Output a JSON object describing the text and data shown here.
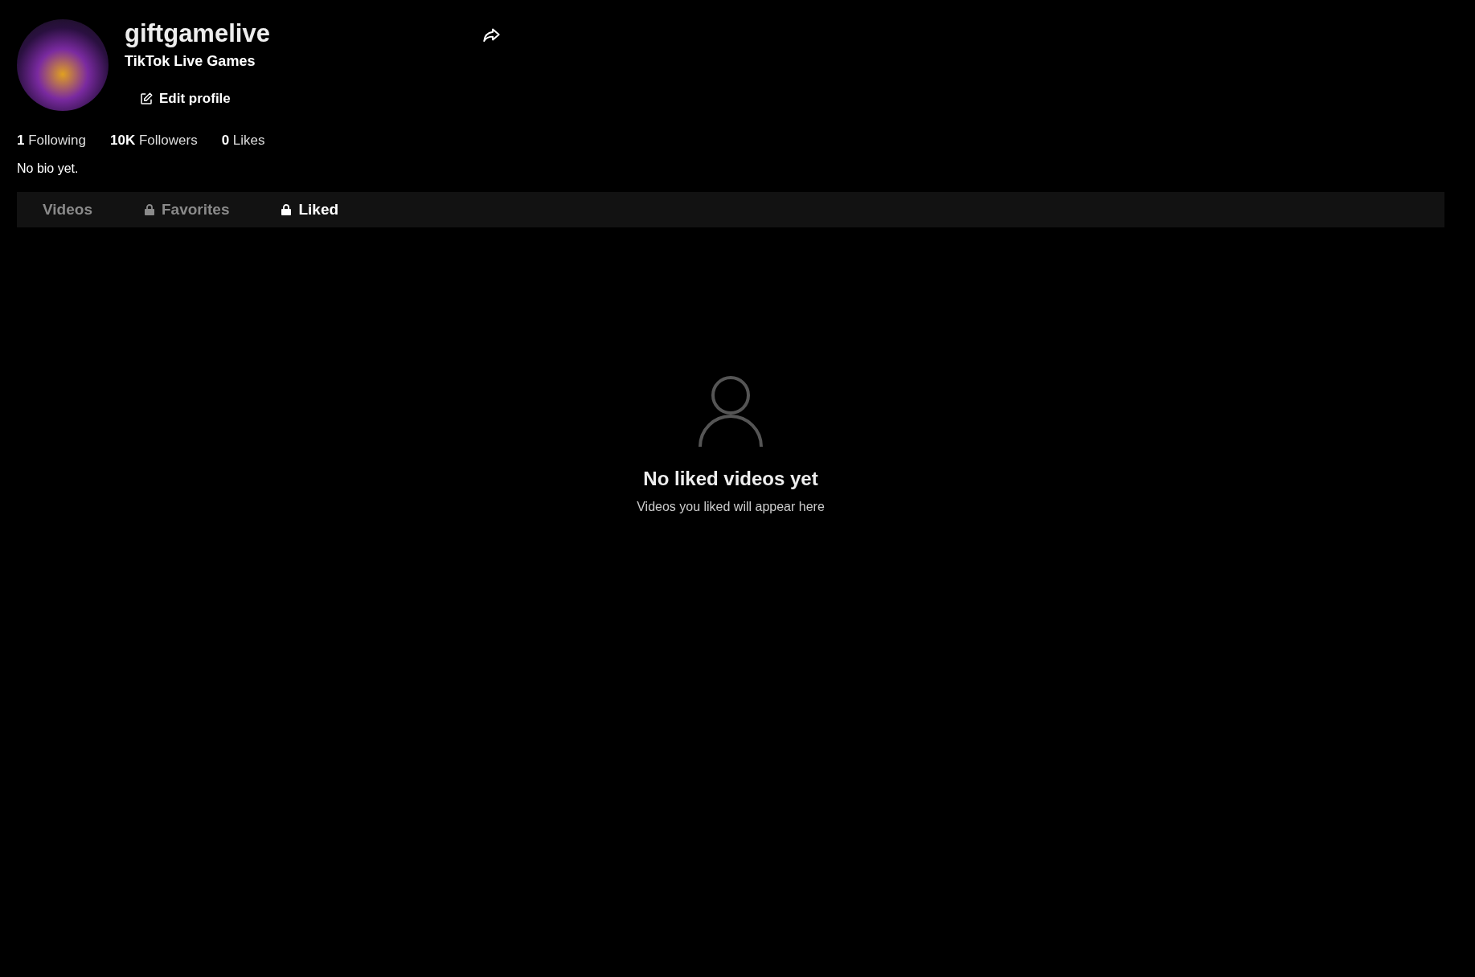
{
  "profile": {
    "username": "giftgamelive",
    "display_name": "TikTok Live Games",
    "edit_button": "Edit profile"
  },
  "stats": [
    "**1** Following",
    "**10K** Followers",
    "**0** Likes"
  ],
  "bio": "No bio yet.",
  "tabs": [
    {
      "label": "Videos",
      "locked": false,
      "selected": false
    },
    {
      "label": "Favorites",
      "locked": true,
      "selected": false
    },
    {
      "label": "Liked",
      "locked": true,
      "selected": true
    }
  ],
  "empty_state": {
    "title": "No liked videos yet",
    "message": "Videos you liked will appear here"
  }
}
